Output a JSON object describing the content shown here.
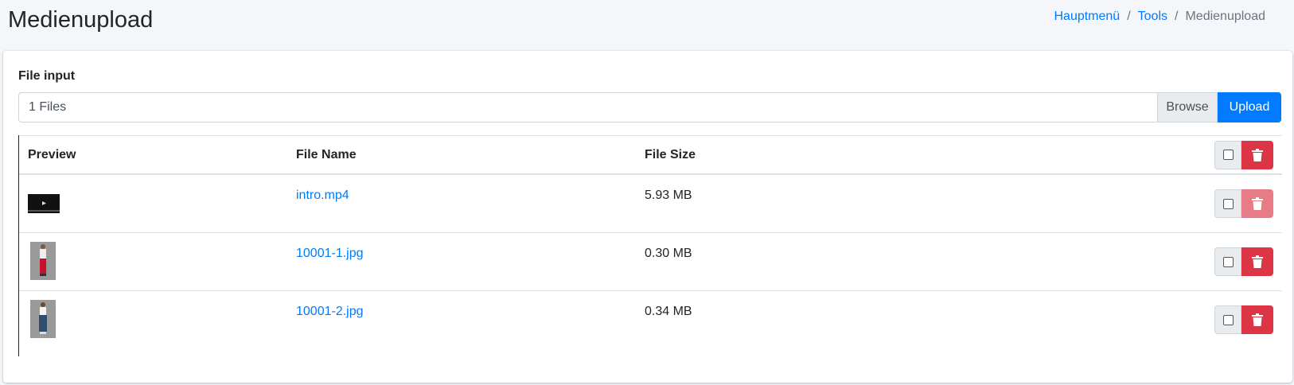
{
  "header": {
    "title": "Medienupload",
    "breadcrumb": {
      "home": "Hauptmenü",
      "tools": "Tools",
      "current": "Medienupload",
      "separator": "/"
    }
  },
  "upload": {
    "label": "File input",
    "file_display": "1 Files",
    "browse_label": "Browse",
    "upload_label": "Upload"
  },
  "table": {
    "headers": {
      "preview": "Preview",
      "name": "File Name",
      "size": "File Size"
    },
    "rows": [
      {
        "name": "intro.mp4",
        "size": "5.93 MB",
        "preview": "video-thumbnail",
        "delete_disabled": true
      },
      {
        "name": "10001-1.jpg",
        "size": "0.30 MB",
        "preview": "image-thumbnail-red-pants",
        "delete_disabled": false
      },
      {
        "name": "10001-2.jpg",
        "size": "0.34 MB",
        "preview": "image-thumbnail-jeans",
        "delete_disabled": false
      }
    ]
  },
  "colors": {
    "primary": "#007bff",
    "danger": "#dc3545",
    "danger_disabled": "#e87c86",
    "background": "#f4f6f9"
  },
  "icons": {
    "delete": "trash-icon",
    "select": "checkbox"
  }
}
